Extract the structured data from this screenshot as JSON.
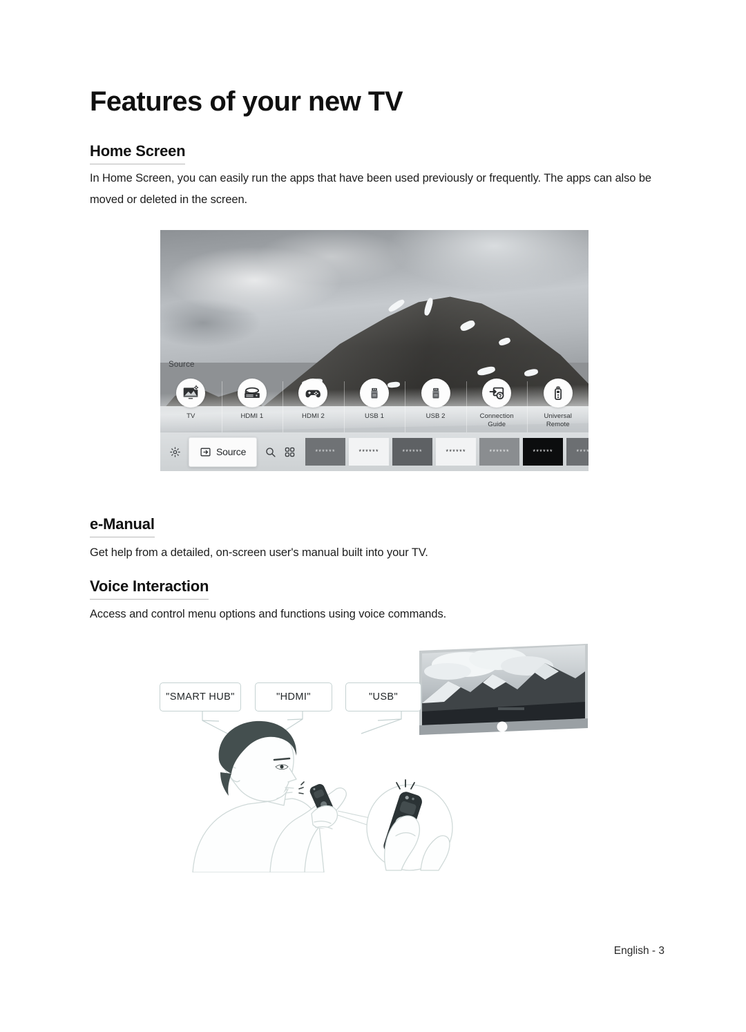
{
  "page": {
    "title": "Features of your new TV",
    "footer": "English - 3"
  },
  "sections": [
    {
      "heading": "Home Screen",
      "body": "In Home Screen, you can easily run the apps that have been used previously or frequently. The apps can also be moved or deleted in the screen."
    },
    {
      "heading": "e-Manual",
      "body": "Get help from a detailed, on-screen user's manual built into your TV."
    },
    {
      "heading": "Voice Interaction",
      "body": "Access and control menu options and functions using voice commands."
    }
  ],
  "home_screen_figure": {
    "source_label": "Source",
    "sources": [
      {
        "label": "TV",
        "icon": "tv-icon"
      },
      {
        "label": "HDMI 1",
        "icon": "bluray-player-icon"
      },
      {
        "label": "HDMI 2",
        "icon": "game-controller-icon"
      },
      {
        "label": "USB 1",
        "icon": "usb-drive-icon"
      },
      {
        "label": "USB 2",
        "icon": "usb-drive-icon"
      },
      {
        "label": "Connection Guide",
        "icon": "connection-guide-icon"
      },
      {
        "label": "Universal Remote",
        "icon": "universal-remote-icon"
      }
    ],
    "taskbar": {
      "settings_icon": "gear-icon",
      "source_label": "Source",
      "source_icon": "source-input-icon",
      "search_icon": "search-icon",
      "apps_icon": "apps-grid-icon",
      "app_tiles": [
        {
          "placeholder": "******",
          "bg": "#6f7275",
          "fg": "#dfe1e3"
        },
        {
          "placeholder": "******",
          "bg": "#f2f3f4",
          "fg": "#1d1f21"
        },
        {
          "placeholder": "******",
          "bg": "#5e6164",
          "fg": "#e3e5e6"
        },
        {
          "placeholder": "******",
          "bg": "#f2f3f4",
          "fg": "#1d1f21"
        },
        {
          "placeholder": "******",
          "bg": "#8a8d90",
          "fg": "#f0f1f2"
        },
        {
          "placeholder": "******",
          "bg": "#0c0d0e",
          "fg": "#f2f3f4"
        },
        {
          "placeholder": "******",
          "bg": "#6c6f72",
          "fg": "#e6e8e9"
        },
        {
          "placeholder": "******",
          "bg": "#a2a5a7",
          "fg": "#f4f5f6"
        },
        {
          "placeholder": "***",
          "bg": "#121314",
          "fg": "#f2f3f4"
        }
      ]
    }
  },
  "voice_figure": {
    "bubbles": [
      {
        "text": "\"SMART HUB\"",
        "name": "speech-bubble-smart-hub"
      },
      {
        "text": "\"HDMI\"",
        "name": "speech-bubble-hdmi"
      },
      {
        "text": "\"USB\"",
        "name": "speech-bubble-usb"
      }
    ],
    "person_alt": "man-speaking-into-remote-illustration",
    "tv_alt": "tv-showing-mountain-landscape-illustration",
    "magnifier_alt": "magnified-remote-microphone-button"
  },
  "colors": {
    "text": "#1c1c1c",
    "heading_rule": "#b9b9b9",
    "bubble_border": "#c5d2d2"
  }
}
